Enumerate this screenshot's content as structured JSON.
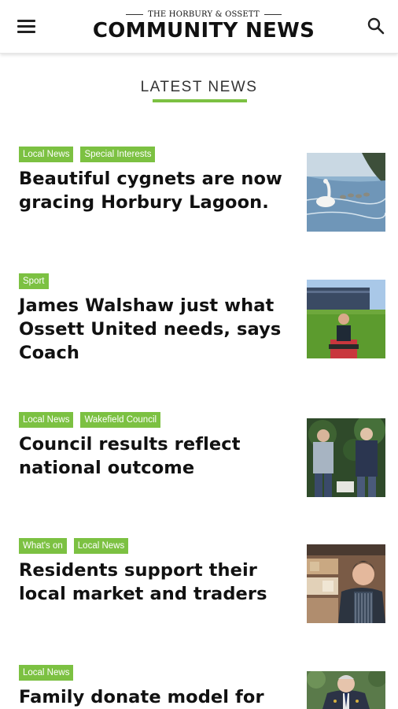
{
  "header": {
    "logo_top": "THE HORBURY & OSSETT",
    "logo_main": "COMMUNITY NEWS"
  },
  "section": {
    "title": "LATEST NEWS"
  },
  "articles": [
    {
      "tags": [
        "Local News",
        "Special Interests"
      ],
      "headline": "Beautiful cygnets are now gracing Horbury Lagoon."
    },
    {
      "tags": [
        "Sport"
      ],
      "headline": "James Walshaw just what Ossett United needs, says Coach"
    },
    {
      "tags": [
        "Local News",
        "Wakefield Council"
      ],
      "headline": "Council results reflect national outcome"
    },
    {
      "tags": [
        "What's on",
        "Local News"
      ],
      "headline": "Residents support their local market and traders"
    },
    {
      "tags": [
        "Local News"
      ],
      "headline": "Family donate model for"
    }
  ],
  "colors": {
    "accent": "#7cc142",
    "text": "#111111"
  },
  "icons": {
    "menu": "hamburger-menu-icon",
    "search": "search-icon"
  }
}
